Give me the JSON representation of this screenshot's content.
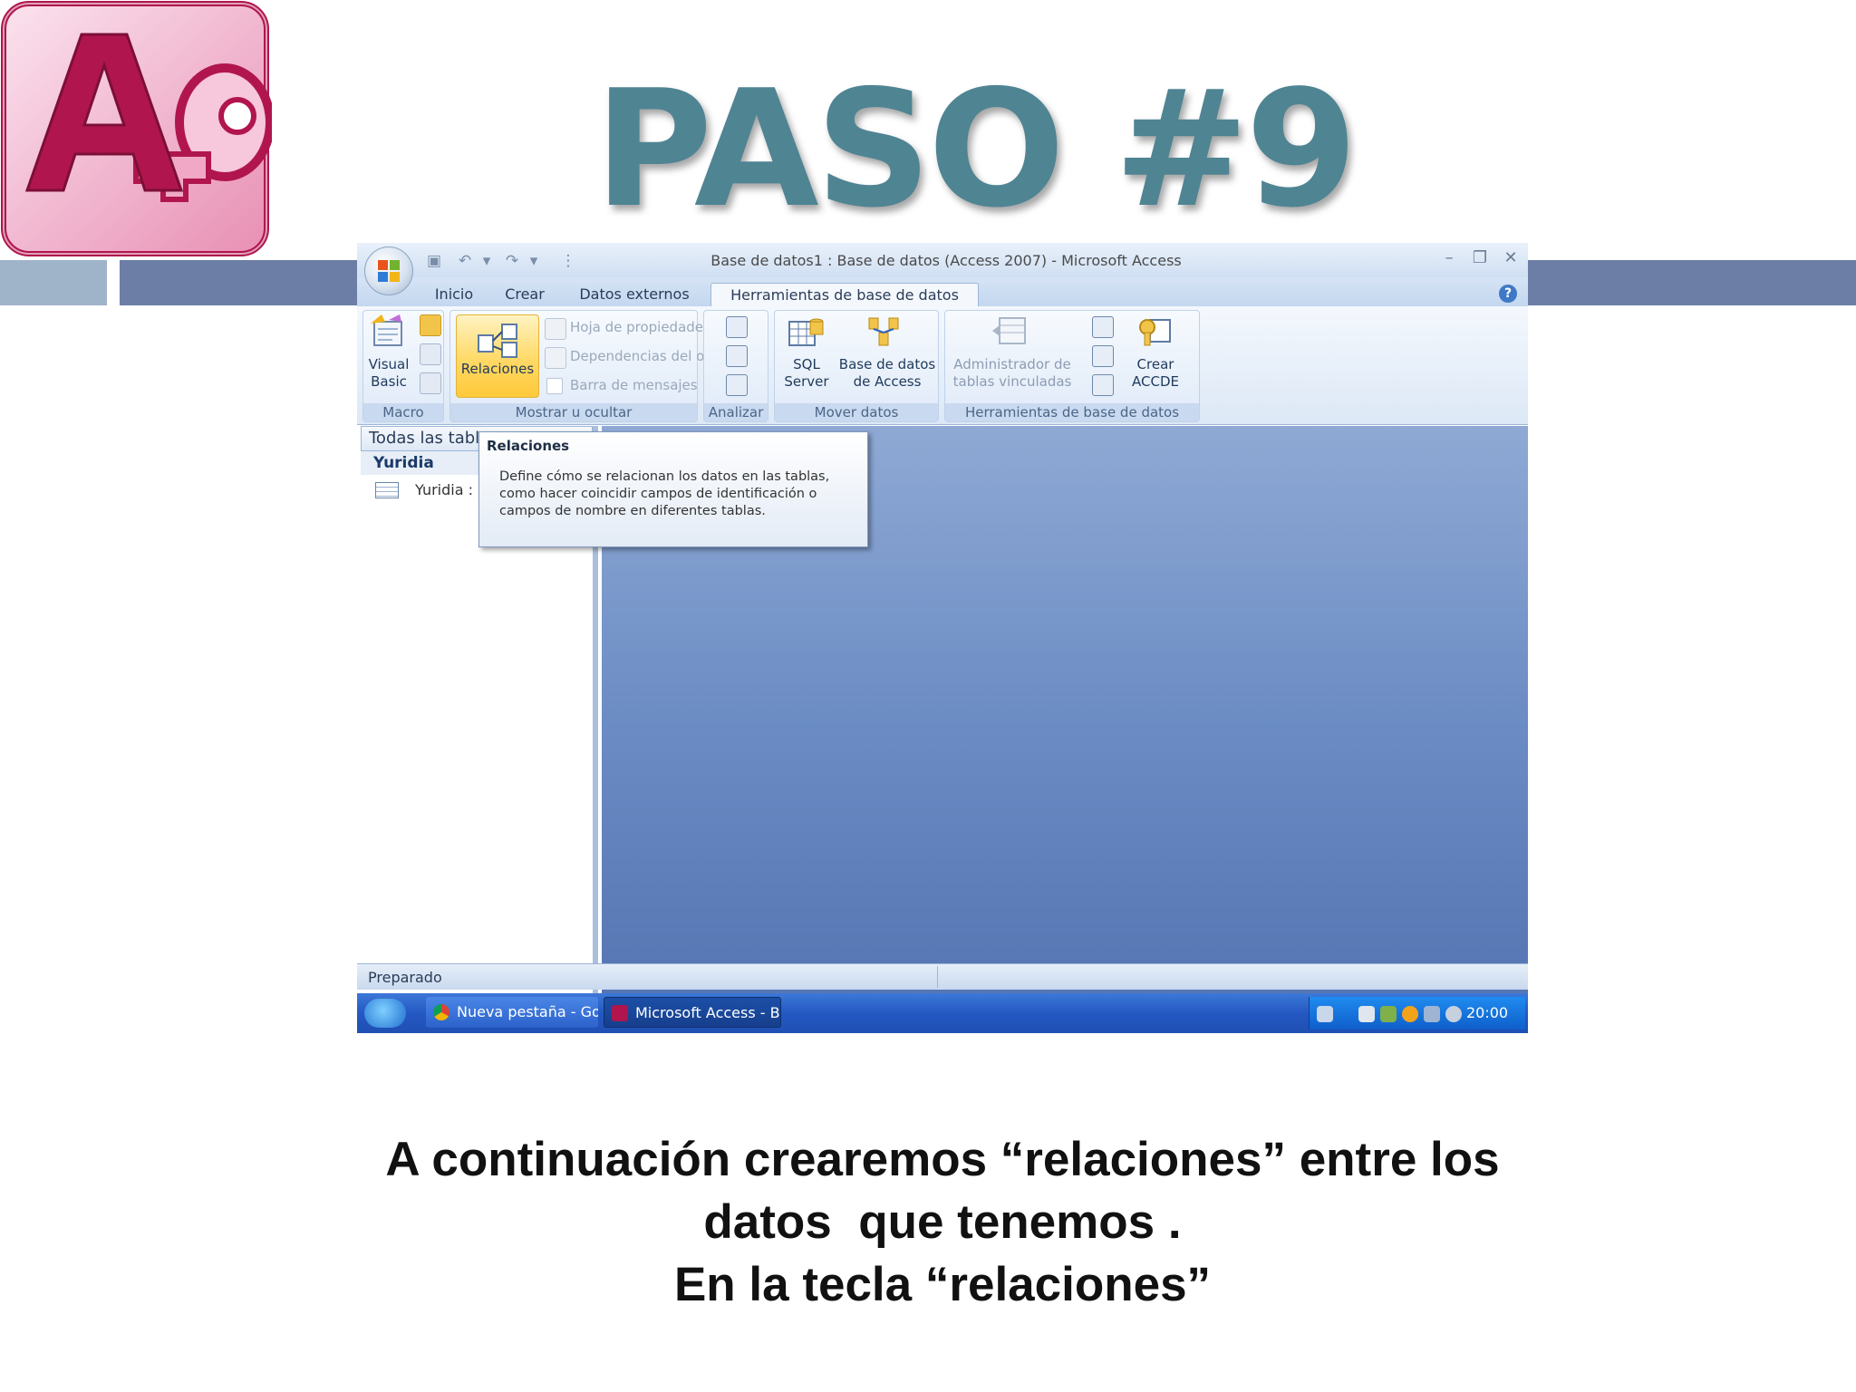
{
  "slide": {
    "title": "PASO #9",
    "caption_lines": [
      "A continuación crearemos “relaciones” entre los",
      "datos  que tenemos .",
      "En la tecla “relaciones”"
    ],
    "logo_icon": "access-logo-icon"
  },
  "window": {
    "title": "Base de datos1 : Base de datos (Access 2007) - Microsoft Access",
    "tabs": [
      "Inicio",
      "Crear",
      "Datos externos",
      "Herramientas de base de datos"
    ],
    "active_tab": "Herramientas de base de datos"
  },
  "ribbon": {
    "macro": {
      "label": "Macro",
      "visual_basic_line1": "Visual",
      "visual_basic_line2": "Basic"
    },
    "mostrar": {
      "label": "Mostrar u ocultar",
      "relaciones": "Relaciones",
      "hoja_propiedades": "Hoja de propiedades",
      "dependencias": "Dependencias del objeto",
      "barra_mensajes": "Barra de mensajes"
    },
    "analizar": {
      "label": "Analizar"
    },
    "mover": {
      "label": "Mover datos",
      "sql_line1": "SQL",
      "sql_line2": "Server",
      "access_line1": "Base de datos",
      "access_line2": "de Access"
    },
    "herramientas": {
      "label": "Herramientas de base de datos",
      "admin_line1": "Administrador de",
      "admin_line2": "tablas vinculadas",
      "accde_line1": "Crear",
      "accde_line2": "ACCDE"
    }
  },
  "nav": {
    "header": "Todas las tablas",
    "group": "Yuridia",
    "item": "Yuridia :"
  },
  "tooltip": {
    "title": "Relaciones",
    "body": "Define cómo se relacionan los datos en las tablas, como hacer coincidir campos de identificación o campos de nombre en diferentes tablas."
  },
  "status": {
    "text": "Preparado"
  },
  "taskbar": {
    "chrome_task": "Nueva pestaña - Goo...",
    "access_task": "Microsoft Access - Ba...",
    "clock": "20:00"
  },
  "colors": {
    "title": "#4f8493",
    "accent_bar": "#6d7ea6",
    "access_brand": "#b0164d"
  }
}
